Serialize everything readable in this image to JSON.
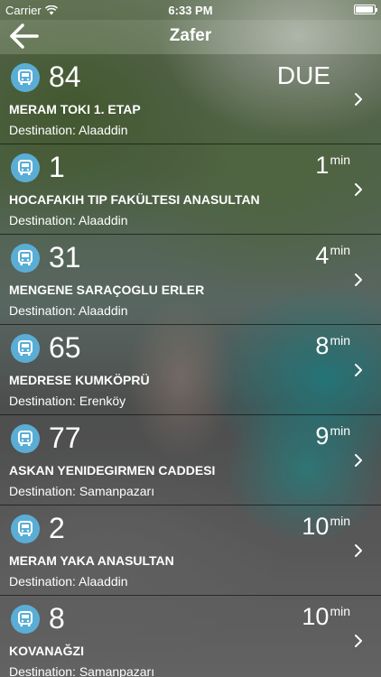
{
  "status_bar": {
    "carrier": "Carrier",
    "time": "6:33 PM",
    "wifi_icon": "wifi-icon",
    "battery_icon": "battery-icon",
    "battery_level": 0.95
  },
  "nav": {
    "title": "Zafer",
    "back_icon": "arrow-left-icon"
  },
  "rows": [
    {
      "route": "84",
      "eta_value": "DUE",
      "eta_unit": "",
      "name": "MERAM TOKI 1. ETAP",
      "destination": "Destination: Alaaddin"
    },
    {
      "route": "1",
      "eta_value": "1",
      "eta_unit": "min",
      "name": "HOCAFAKIH TIP FAKÜLTESI ANASULTAN",
      "destination": "Destination: Alaaddin"
    },
    {
      "route": "31",
      "eta_value": "4",
      "eta_unit": "min",
      "name": "MENGENE SARAÇOGLU ERLER",
      "destination": "Destination: Alaaddin"
    },
    {
      "route": "65",
      "eta_value": "8",
      "eta_unit": "min",
      "name": "MEDRESE KUMKÖPRÜ",
      "destination": "Destination: Erenköy"
    },
    {
      "route": "77",
      "eta_value": "9",
      "eta_unit": "min",
      "name": "ASKAN YENIDEGIRMEN CADDESI",
      "destination": "Destination: Samanpazarı"
    },
    {
      "route": "2",
      "eta_value": "10",
      "eta_unit": "min",
      "name": "MERAM YAKA ANASULTAN",
      "destination": "Destination: Alaaddin"
    },
    {
      "route": "8",
      "eta_value": "10",
      "eta_unit": "min",
      "name": "KOVANAĞZI",
      "destination": "Destination: Samanpazarı"
    }
  ],
  "colors": {
    "bus_icon_bg": "#5aaed6",
    "text": "#ffffff"
  }
}
